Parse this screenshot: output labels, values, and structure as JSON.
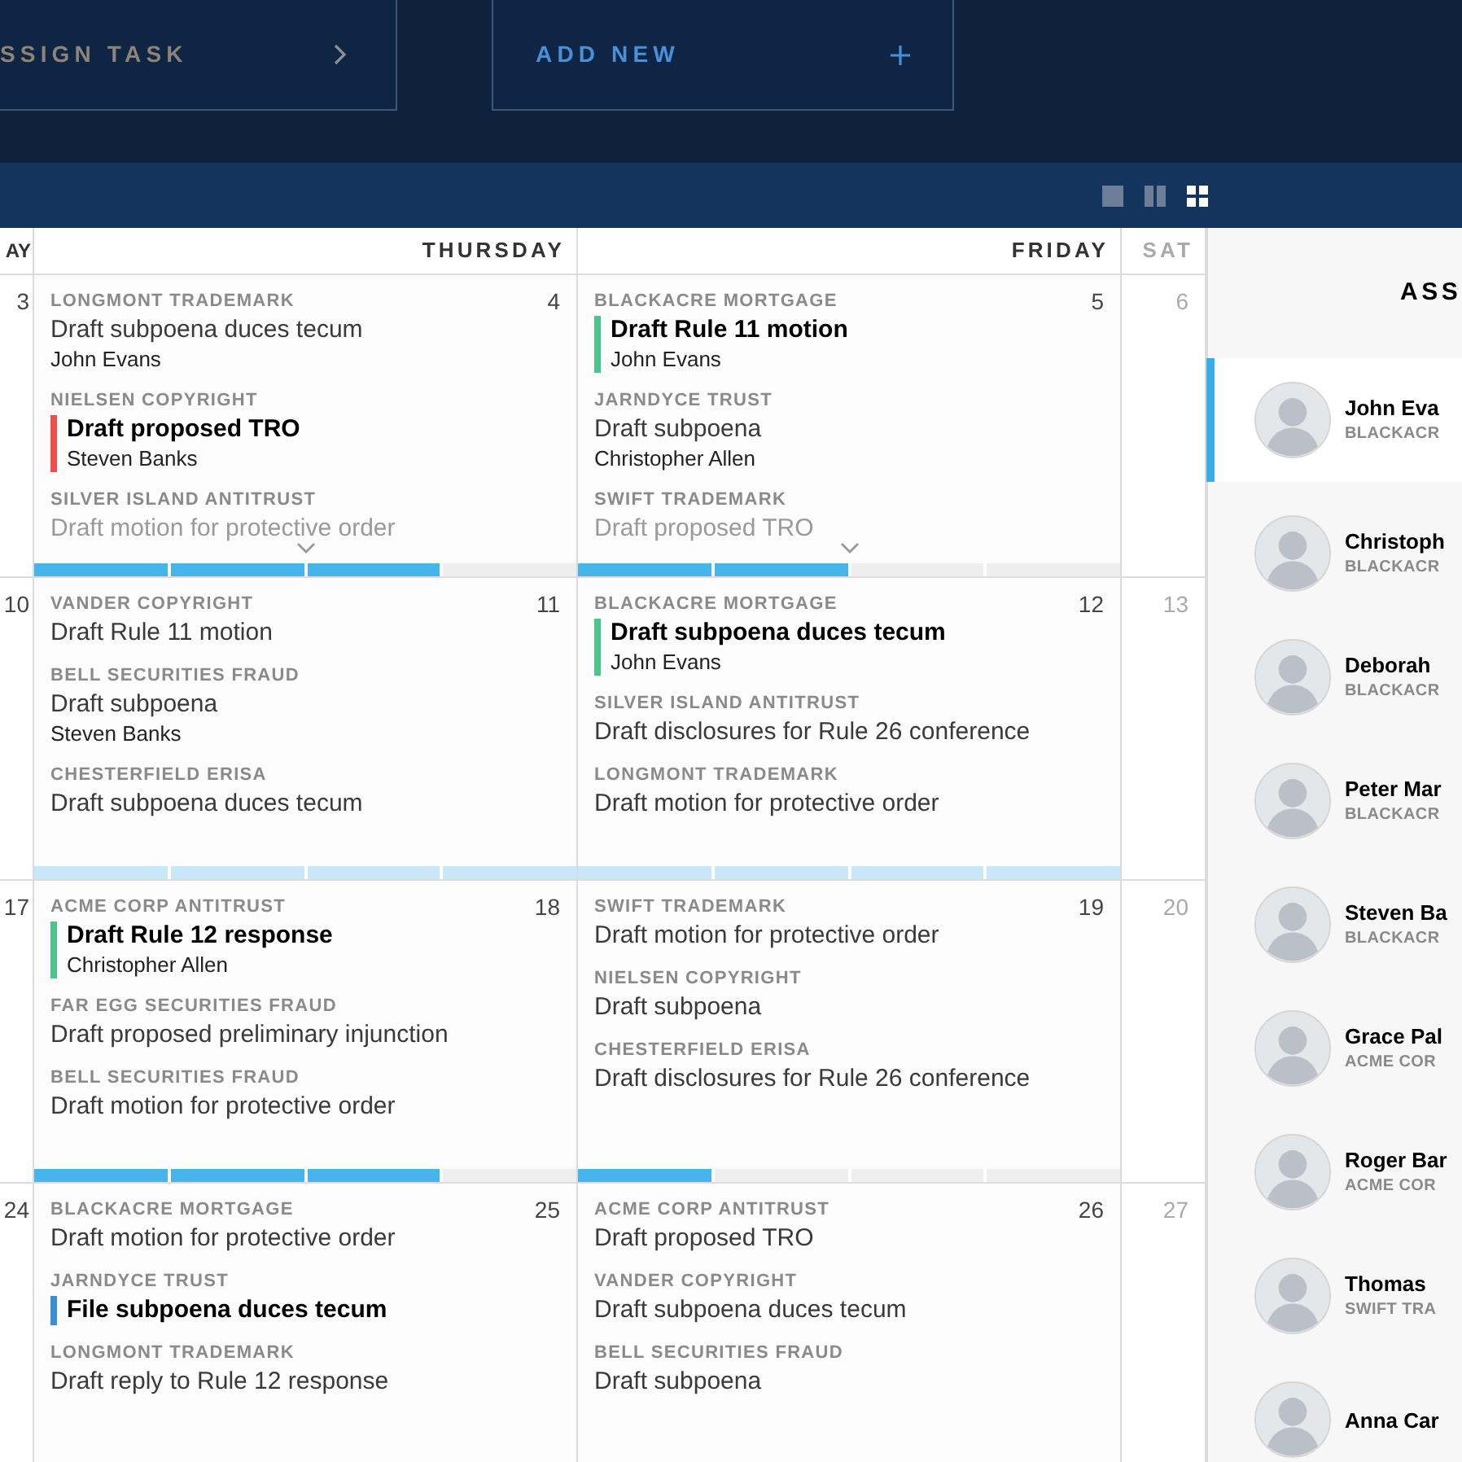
{
  "actions": [
    {
      "kind": "assign",
      "label": "SSIGN TASK"
    },
    {
      "kind": "add",
      "label": "ADD NEW"
    }
  ],
  "view_modes": [
    {
      "kind": "single",
      "selected": false
    },
    {
      "kind": "split",
      "selected": false
    },
    {
      "kind": "grid",
      "selected": true
    }
  ],
  "columns": [
    {
      "label": "AY",
      "muted": false
    },
    {
      "label": "THURSDAY",
      "muted": false
    },
    {
      "label": "FRIDAY",
      "muted": false
    },
    {
      "label": "SAT",
      "muted": true
    }
  ],
  "weeks": [
    {
      "days": [
        {
          "number": "3"
        },
        {
          "number": "4",
          "more": true,
          "progress": {
            "level": 0.75,
            "light": false
          },
          "tasks": [
            {
              "kind": "normal",
              "matter": "LONGMONT TRADEMARK",
              "title": "Draft subpoena duces tecum",
              "assignee": "John Evans"
            },
            {
              "kind": "flagged",
              "color": "#f04e4e",
              "matter": "NIELSEN COPYRIGHT",
              "title": "Draft proposed TRO",
              "assignee": "Steven Banks"
            },
            {
              "kind": "faded",
              "matter": "SILVER ISLAND ANTITRUST",
              "title": "Draft motion for protective order"
            }
          ]
        },
        {
          "number": "5",
          "more": true,
          "progress": {
            "level": 0.5,
            "light": false
          },
          "tasks": [
            {
              "kind": "flagged",
              "color": "#4cc48a",
              "matter": "BLACKACRE MORTGAGE",
              "title": "Draft Rule 11 motion",
              "assignee": "John Evans"
            },
            {
              "kind": "normal",
              "matter": "JARNDYCE TRUST",
              "title": "Draft subpoena",
              "assignee": "Christopher Allen"
            },
            {
              "kind": "faded",
              "matter": "SWIFT TRADEMARK",
              "title": "Draft proposed TRO"
            }
          ]
        },
        {
          "number": "6"
        }
      ]
    },
    {
      "days": [
        {
          "number": "10"
        },
        {
          "number": "11",
          "more": false,
          "progress": {
            "level": 1,
            "light": true
          },
          "tasks": [
            {
              "kind": "normal",
              "matter": "VANDER COPYRIGHT",
              "title": "Draft Rule 11 motion"
            },
            {
              "kind": "normal",
              "matter": "BELL SECURITIES FRAUD",
              "title": "Draft subpoena",
              "assignee": "Steven Banks"
            },
            {
              "kind": "normal",
              "matter": "CHESTERFIELD ERISA",
              "title": "Draft subpoena duces tecum"
            }
          ]
        },
        {
          "number": "12",
          "more": false,
          "progress": {
            "level": 1,
            "light": true
          },
          "tasks": [
            {
              "kind": "flagged",
              "color": "#4cc48a",
              "matter": "BLACKACRE MORTGAGE",
              "title": "Draft subpoena duces tecum",
              "assignee": "John Evans"
            },
            {
              "kind": "normal",
              "matter": "SILVER ISLAND ANTITRUST",
              "title": "Draft disclosures for Rule 26 conference"
            },
            {
              "kind": "normal",
              "matter": "LONGMONT TRADEMARK",
              "title": "Draft motion for protective order"
            }
          ]
        },
        {
          "number": "13"
        }
      ]
    },
    {
      "days": [
        {
          "number": "17"
        },
        {
          "number": "18",
          "more": false,
          "progress": {
            "level": 0.75,
            "light": false
          },
          "tasks": [
            {
              "kind": "flagged",
              "color": "#4cc48a",
              "matter": "ACME CORP ANTITRUST",
              "title": "Draft Rule 12 response",
              "assignee": "Christopher Allen"
            },
            {
              "kind": "normal",
              "matter": "FAR EGG SECURITIES FRAUD",
              "title": "Draft proposed preliminary injunction"
            },
            {
              "kind": "normal",
              "matter": "BELL SECURITIES FRAUD",
              "title": "Draft motion for protective order"
            }
          ]
        },
        {
          "number": "19",
          "more": false,
          "progress": {
            "level": 0.25,
            "light": false
          },
          "tasks": [
            {
              "kind": "normal",
              "matter": "SWIFT TRADEMARK",
              "title": "Draft motion for protective order"
            },
            {
              "kind": "normal",
              "matter": "NIELSEN COPYRIGHT",
              "title": "Draft subpoena"
            },
            {
              "kind": "normal",
              "matter": "CHESTERFIELD ERISA",
              "title": "Draft disclosures for Rule 26 conference"
            }
          ]
        },
        {
          "number": "20"
        }
      ]
    },
    {
      "days": [
        {
          "number": "24"
        },
        {
          "number": "25",
          "more": false,
          "tasks": [
            {
              "kind": "normal",
              "matter": "BLACKACRE MORTGAGE",
              "title": "Draft motion for protective order"
            },
            {
              "kind": "flagged",
              "color": "#3b8fd9",
              "matter": "JARNDYCE TRUST",
              "title": "File subpoena duces tecum"
            },
            {
              "kind": "normal",
              "matter": "LONGMONT TRADEMARK",
              "title": "Draft reply to Rule 12 response"
            }
          ]
        },
        {
          "number": "26",
          "more": false,
          "tasks": [
            {
              "kind": "normal",
              "matter": "ACME CORP ANTITRUST",
              "title": "Draft proposed TRO"
            },
            {
              "kind": "normal",
              "matter": "VANDER COPYRIGHT",
              "title": "Draft subpoena duces tecum"
            },
            {
              "kind": "normal",
              "matter": "BELL SECURITIES FRAUD",
              "title": "Draft subpoena"
            }
          ]
        },
        {
          "number": "27"
        }
      ]
    }
  ],
  "sidebar": {
    "title": "ASS",
    "people": [
      {
        "name": "John Eva",
        "matter": "BLACKACR",
        "selected": true
      },
      {
        "name": "Christoph",
        "matter": "BLACKACR",
        "selected": false
      },
      {
        "name": "Deborah",
        "matter": "BLACKACR",
        "selected": false
      },
      {
        "name": "Peter Mar",
        "matter": "BLACKACR",
        "selected": false
      },
      {
        "name": "Steven Ba",
        "matter": "BLACKACR",
        "selected": false
      },
      {
        "name": "Grace Pal",
        "matter": "ACME COR",
        "selected": false
      },
      {
        "name": "Roger Bar",
        "matter": "ACME COR",
        "selected": false
      },
      {
        "name": "Thomas",
        "matter": "SWIFT TRA",
        "selected": false
      },
      {
        "name": "Anna Car",
        "selected": false
      }
    ]
  }
}
